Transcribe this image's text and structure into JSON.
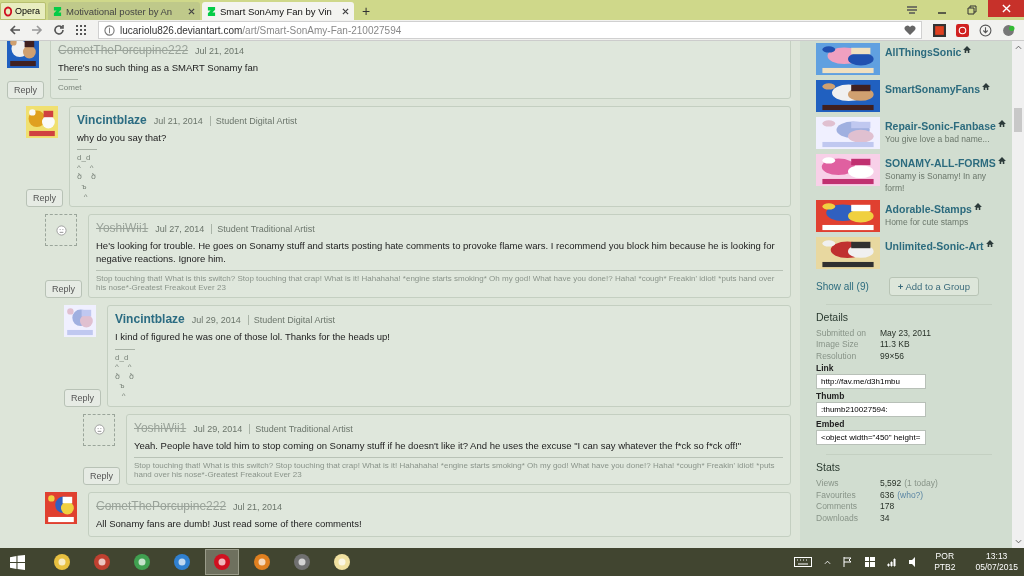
{
  "browser": {
    "menu_label": "Opera",
    "tabs": [
      {
        "title": "Motivational poster by An",
        "selected": false
      },
      {
        "title": "Smart SonAmy Fan by Vin",
        "selected": true
      }
    ],
    "new_tab": "+",
    "address": {
      "host": "lucariolu826.deviantart.com",
      "path": "/art/Smart-SonAmy-Fan-210027594"
    }
  },
  "comments": [
    {
      "avatar": {
        "kind": "picture"
      },
      "name": "CometThePorcupine222",
      "name_struck": true,
      "date": "Jul 21, 2014",
      "body": "There's no such thing as a SMART Sonamy fan",
      "signature": {
        "kind": "short",
        "lines": [
          "Comet"
        ]
      },
      "reply": "Reply",
      "children": [
        {
          "avatar": {
            "kind": "picture"
          },
          "name": "Vincintblaze",
          "name_struck": false,
          "date": "Jul 21, 2014",
          "role": "Student Digital Artist",
          "body": "why do you say that?",
          "signature": {
            "kind": "short",
            "lines": [
              "d_d",
              "^    ^",
              "ծ    ծ",
              "  ъ",
              "   ^"
            ]
          },
          "reply": "Reply",
          "children": [
            {
              "avatar": {
                "kind": "deleted"
              },
              "name": "YoshiWii1",
              "name_struck": true,
              "date": "Jul 27, 2014",
              "role": "Student Traditional Artist",
              "body": "He's looking for trouble. He goes on Sonamy stuff and starts posting hate comments to provoke flame wars. I recommend you block him because he is looking for negative reactions. Ignore him.",
              "signature": {
                "kind": "full",
                "lines": [
                  "Stop touching that! What is this switch? Stop touching that crap! What is it! Hahahaha! *engine starts smoking* Oh my god! What have you done!? Haha! *cough* Freakin' idiot! *puts hand over his nose*-Greatest Freakout Ever 23"
                ]
              },
              "reply": "Reply",
              "children": [
                {
                  "avatar": {
                    "kind": "picture"
                  },
                  "name": "Vincintblaze",
                  "name_struck": false,
                  "date": "Jul 29, 2014",
                  "role": "Student Digital Artist",
                  "body": "I kind of figured he was one of those lol. Thanks for the heads up!",
                  "signature": {
                    "kind": "short",
                    "lines": [
                      "d_d",
                      "^    ^",
                      "ծ    ծ",
                      "  ъ",
                      "   ^"
                    ]
                  },
                  "reply": "Reply",
                  "children": [
                    {
                      "avatar": {
                        "kind": "deleted"
                      },
                      "name": "YoshiWii1",
                      "name_struck": true,
                      "date": "Jul 29, 2014",
                      "role": "Student Traditional Artist",
                      "body": "Yeah. People have told him to stop coming on Sonamy stuff if he doesn't like it? And he uses the excuse \"I can say whatever the f*ck so f*ck off!\"",
                      "signature": {
                        "kind": "full",
                        "lines": [
                          "Stop touching that! What is this switch? Stop touching that crap! What is it! Hahahaha! *engine starts smoking* Oh my god! What have you done!? Haha! *cough* Freakin' idiot! *puts hand over his nose*-Greatest Freakout Ever 23"
                        ]
                      },
                      "reply": "Reply"
                    }
                  ]
                }
              ]
            },
            {
              "avatar": {
                "kind": "picture"
              },
              "name": "CometThePorcupine222",
              "name_struck": true,
              "date": "Jul 21, 2014",
              "body": "All Sonamy fans are dumb! Just read some of there comments!"
            }
          ]
        }
      ]
    }
  ],
  "groups": [
    {
      "name": "AllThingsSonic"
    },
    {
      "name": "SmartSonamyFans"
    },
    {
      "name": "Repair-Sonic-Fanbase",
      "description": "You give love a bad name..."
    },
    {
      "name": "SONAMY-ALL-FORMS",
      "description": "Sonamy is Sonamy! In any form!"
    },
    {
      "name": "Adorable-Stamps",
      "description": "Home for cute stamps"
    },
    {
      "name": "Unlimited-Sonic-Art"
    }
  ],
  "groups_show_all": "Show all (9)",
  "add_group": {
    "icon": "+",
    "label": "Add to a Group"
  },
  "details": {
    "title": "Details",
    "rows": [
      {
        "label": "Submitted on",
        "value": "May 23, 2011"
      },
      {
        "label": "Image Size",
        "value": "11.3 KB"
      },
      {
        "label": "Resolution",
        "value": "99×56"
      }
    ],
    "fields": [
      {
        "label": "Link",
        "value": "http://fav.me/d3h1mbu"
      },
      {
        "label": "Thumb",
        "value": ":thumb210027594:"
      },
      {
        "label": "Embed",
        "value": "<object width=\"450\" height="
      }
    ]
  },
  "stats": {
    "title": "Stats",
    "rows": [
      {
        "label": "Views",
        "value": "5,592",
        "extra": "(1 today)",
        "extra_link": false
      },
      {
        "label": "Favourites",
        "value": "636",
        "extra": "(who?)",
        "extra_link": true
      },
      {
        "label": "Comments",
        "value": "178"
      },
      {
        "label": "Downloads",
        "value": "34"
      }
    ]
  },
  "taskbar": {
    "apps": [
      {
        "active": false
      },
      {
        "active": false
      },
      {
        "active": false
      },
      {
        "active": false
      },
      {
        "active": true
      },
      {
        "active": false
      },
      {
        "active": false
      },
      {
        "active": false
      }
    ],
    "language": "POR",
    "layout": "PTB2",
    "time": "13:13",
    "date": "05/07/2015"
  }
}
